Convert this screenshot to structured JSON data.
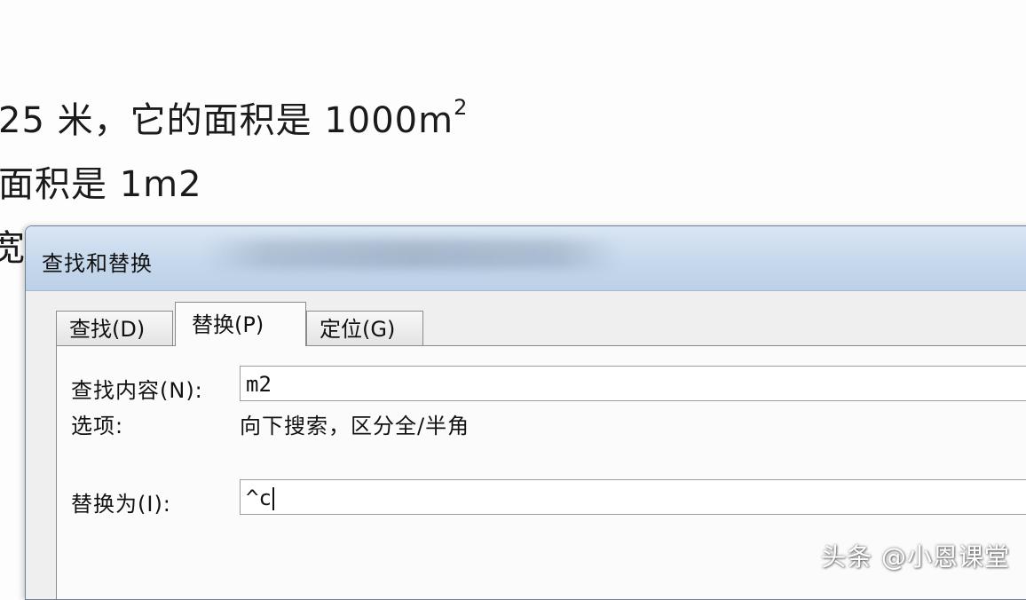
{
  "document": {
    "line1_text": "25 米，它的面积是 1000m",
    "line1_superscript": "2",
    "line2_text": "面积是 1m2",
    "line3_text": "宽"
  },
  "dialog": {
    "title": "查找和替换",
    "tabs": [
      {
        "label": "查找(D)",
        "active": false
      },
      {
        "label": "替换(P)",
        "active": true
      },
      {
        "label": "定位(G)",
        "active": false
      }
    ],
    "find": {
      "label": "查找内容(N):",
      "value": "m2"
    },
    "options": {
      "label": "选项:",
      "value": "向下搜索，区分全/半角"
    },
    "replace": {
      "label": "替换为(I):",
      "value": "^c"
    }
  },
  "watermark": "头条 @小恩课堂",
  "colors": {
    "titlebar": "#c6d8ec",
    "dialog_bg": "#efefef",
    "panel_bg": "#fbfbfb"
  }
}
